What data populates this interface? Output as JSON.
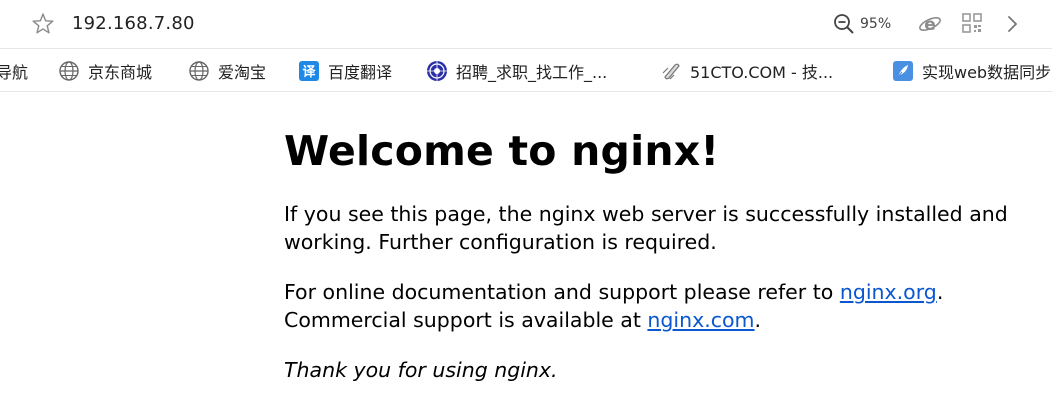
{
  "address_bar": {
    "url": "192.168.7.80",
    "zoom": "95%",
    "icons": [
      "star-icon",
      "zoom-icon",
      "ie-icon",
      "qr-code-icon",
      "chevron-right-icon"
    ]
  },
  "bookmarks": [
    {
      "label": "导航",
      "icon": "none"
    },
    {
      "label": "京东商城",
      "icon": "globe-icon"
    },
    {
      "label": "爱淘宝",
      "icon": "globe-icon"
    },
    {
      "label": "百度翻译",
      "icon": "baidu-translate-icon"
    },
    {
      "label": "招聘_求职_找工作_...",
      "icon": "recruit-site-icon"
    },
    {
      "label": "51CTO.COM - 技...",
      "icon": "51cto-icon"
    },
    {
      "label": "实现web数据同步",
      "icon": "feather-icon"
    }
  ],
  "page": {
    "heading": "Welcome to nginx!",
    "p1": "If you see this page, the nginx web server is successfully installed and working. Further configuration is required.",
    "p2_before_link1": "For online documentation and support please refer to ",
    "link1": "nginx.org",
    "p2_after_link1": ".",
    "p2_line2_before_link2": "Commercial support is available at ",
    "link2": "nginx.com",
    "p2_after_link2": ".",
    "p3": "Thank you for using nginx."
  },
  "colors": {
    "link": "#0b57d0",
    "translate_badge": "#1e88e5",
    "feather_badge": "#4a90e2"
  }
}
